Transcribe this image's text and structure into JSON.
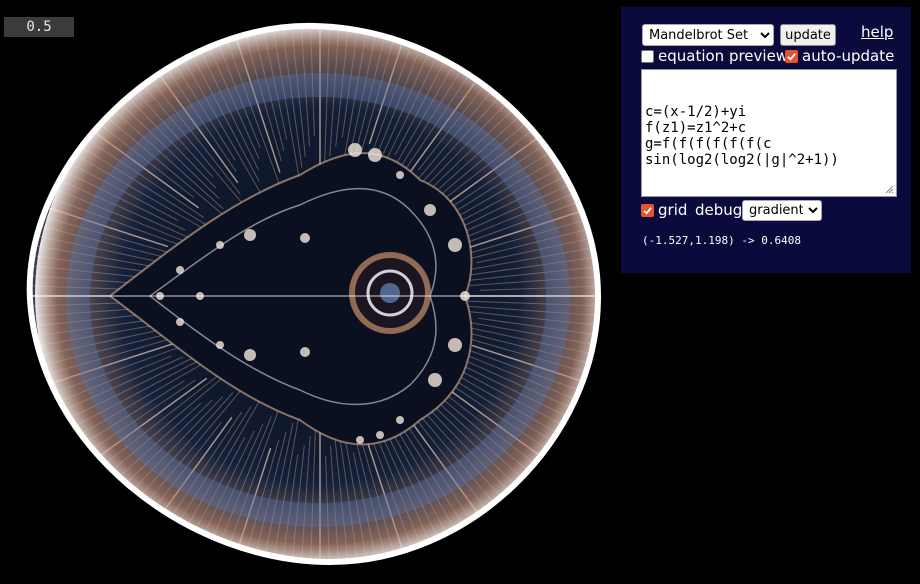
{
  "viewer": {
    "scale": "0.5"
  },
  "panel": {
    "preset_options": [
      "Mandelbrot Set"
    ],
    "preset_selected": "Mandelbrot Set",
    "update_label": "update",
    "help_label": "help",
    "equation_preview_label": "equation preview",
    "equation_preview_checked": false,
    "auto_update_label": "auto-update",
    "auto_update_checked": true,
    "equation_text": "c=(x-1/2)+yi\nf(z1)=z1^2+c\ng=f(f(f(f(f(f(c\nsin(log2(log2(|g|^2+1))",
    "grid_label": "grid",
    "grid_checked": true,
    "debug_label": "debug",
    "gradient_options": [
      "gradient"
    ],
    "gradient_selected": "gradient",
    "coordinate_readout": "(-1.527,1.198) -> 0.6408"
  },
  "colors": {
    "panel_bg": "#0a0a3c",
    "checkbox_accent": "#e5532d",
    "scale_bg": "#3b3b3b"
  },
  "icons": {
    "checkmark": "check-icon",
    "resize": "resize-grip-icon"
  }
}
